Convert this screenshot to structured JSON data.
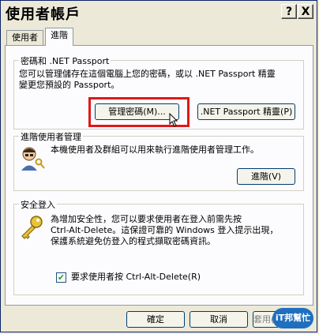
{
  "window": {
    "title": "使用者帳戶",
    "help_label": "?",
    "close_label": "X"
  },
  "tabs": [
    {
      "label": "使用者"
    },
    {
      "label": "進階"
    }
  ],
  "passwords_group": {
    "label": "密碼和 .NET Passport",
    "description_line1": "您可以管理儲存在這個電腦上您的密碼，或以 .NET Passport 精靈",
    "description_line2": "變更您預設的 Passport。",
    "manage_button": "管理密碼(M)...",
    "passport_button": ".NET Passport 精靈(P)"
  },
  "advanced_group": {
    "label": "進階使用者管理",
    "description": "本機使用者及群組可以用來執行進階使用者管理工作。",
    "button": "進階(V)"
  },
  "secure_group": {
    "label": "安全登入",
    "description_line1": "為增加安全性，您可以要求使用者在登入前需先按",
    "description_line2": "Ctrl-Alt-Delete。這保證可靠的 Windows 登入提示出現，",
    "description_line3": "保護系統避免仿登入的程式擷取密碼資訊。",
    "checkbox_label": "要求使用者按 Ctrl-Alt-Delete(R)",
    "checked": true
  },
  "footer": {
    "ok_button": "確定",
    "cancel_button": "取消",
    "apply_button": "套用(A)"
  },
  "watermark": {
    "text": "iT邦幫忙"
  },
  "colors": {
    "highlight": "#e01818",
    "title_border": "#0a246a",
    "button_border": "#003c74"
  }
}
